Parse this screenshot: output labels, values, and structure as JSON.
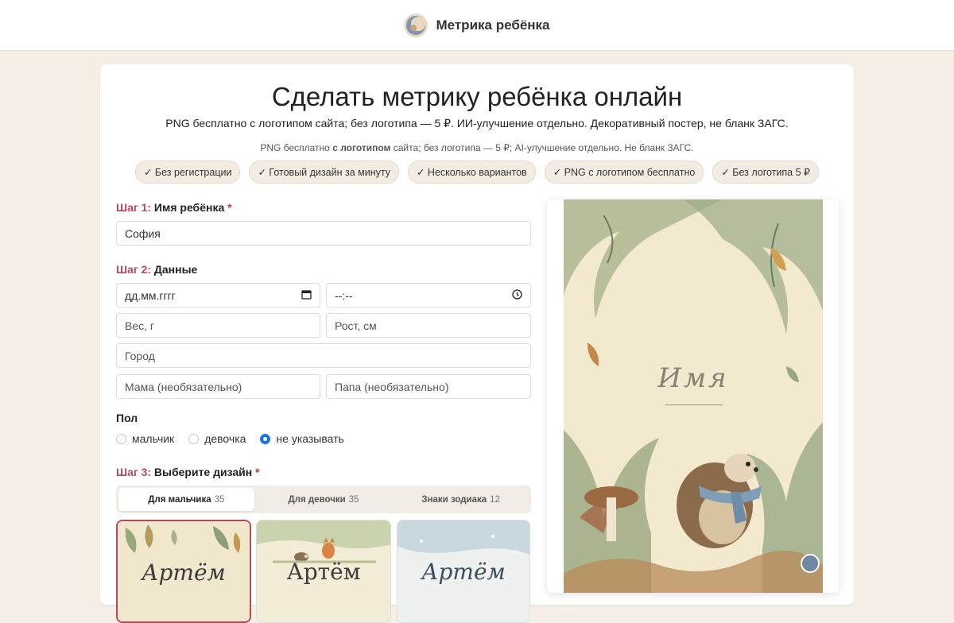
{
  "header": {
    "brand": "Метрика ребёнка",
    "logo_icon": "moon-baby-logo-icon"
  },
  "hero": {
    "title": "Сделать метрику ребёнка онлайн",
    "subtitle": "PNG бесплатно с логотипом сайта; без логотипа — 5 ₽. ИИ-улучшение отдельно. Декоративный постер, не бланк ЗАГС.",
    "note_pre": "PNG бесплатно ",
    "note_bold": "с логотипом",
    "note_post": " сайта; без логотипа — 5 ₽; AI-улучшение отдельно. Не бланк ЗАГС."
  },
  "badges": [
    "✓ Без регистрации",
    "✓ Готовый дизайн за минуту",
    "✓ Несколько вариантов",
    "✓ PNG с логотипом бесплатно",
    "✓ Без логотипа 5 ₽"
  ],
  "step1": {
    "num": "Шаг 1:",
    "label": "Имя ребёнка",
    "required": "*",
    "name_value": "София"
  },
  "step2": {
    "num": "Шаг 2:",
    "label": "Данные",
    "date_value": "дд.мм.гггг",
    "time_value": "--:--",
    "weight_placeholder": "Вес, г",
    "height_placeholder": "Рост, см",
    "city_placeholder": "Город",
    "mother_placeholder": "Мама (необязательно)",
    "father_placeholder": "Папа (необязательно)"
  },
  "gender": {
    "label": "Пол",
    "options": [
      "мальчик",
      "девочка",
      "не указывать"
    ],
    "selected": "не указывать"
  },
  "step3": {
    "num": "Шаг 3:",
    "label": "Выберите дизайн",
    "required": "*",
    "tabs": [
      {
        "label": "Для мальчика",
        "count": "35"
      },
      {
        "label": "Для девочки",
        "count": "35"
      },
      {
        "label": "Знаки зодиака",
        "count": "12"
      }
    ],
    "thumbs": [
      "Артём",
      "Артём",
      "Артём"
    ]
  },
  "preview": {
    "name": "Имя"
  },
  "colors": {
    "accent": "#b04a5c",
    "radio": "#1a73e8",
    "background": "#f6efe6"
  }
}
